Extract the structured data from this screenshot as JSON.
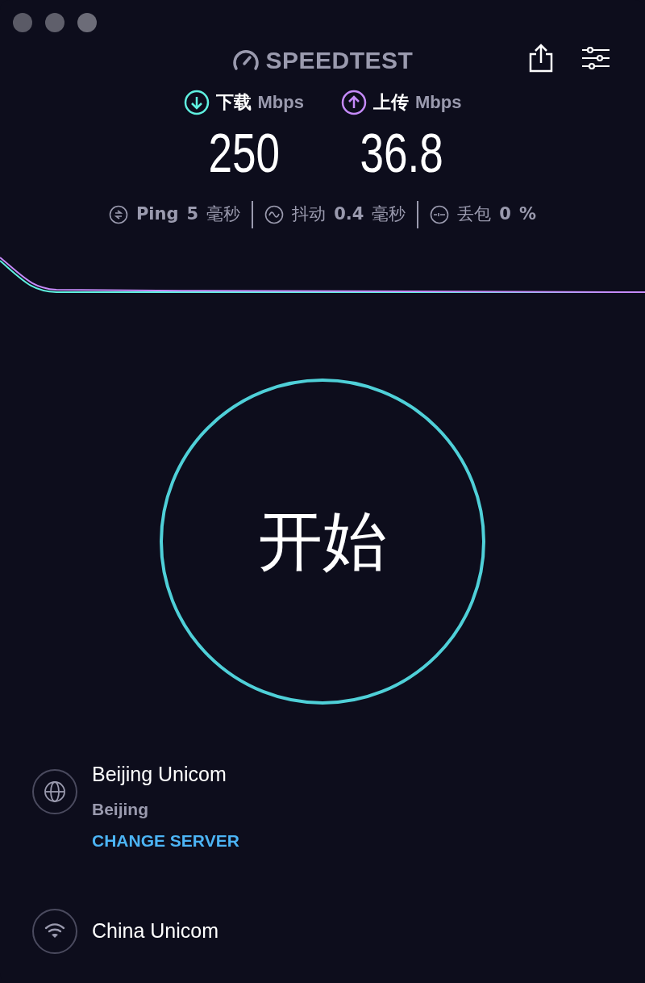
{
  "window": {
    "controls": [
      {
        "kind": "close"
      },
      {
        "kind": "minimize"
      },
      {
        "kind": "zoom"
      }
    ]
  },
  "header": {
    "logo": "SPEEDTEST"
  },
  "metrics": [
    {
      "kind": "download",
      "label": "下载",
      "unit": "Mbps",
      "value": "250",
      "color": "#5ff0e0"
    },
    {
      "kind": "upload",
      "label": "上传",
      "unit": "Mbps",
      "value": "36.8",
      "color": "#c58af9"
    }
  ],
  "stats": [
    {
      "kind": "ping",
      "label": "Ping",
      "value": "5",
      "unit": "毫秒"
    },
    {
      "kind": "jitter",
      "label": "抖动",
      "value": "0.4",
      "unit": "毫秒"
    },
    {
      "kind": "loss",
      "label": "丢包",
      "value": "0",
      "unit": "%"
    }
  ],
  "start_button": {
    "label": "开始"
  },
  "server": {
    "name": "Beijing Unicom",
    "location": "Beijing",
    "action": "CHANGE SERVER"
  },
  "provider": {
    "name": "China Unicom"
  }
}
